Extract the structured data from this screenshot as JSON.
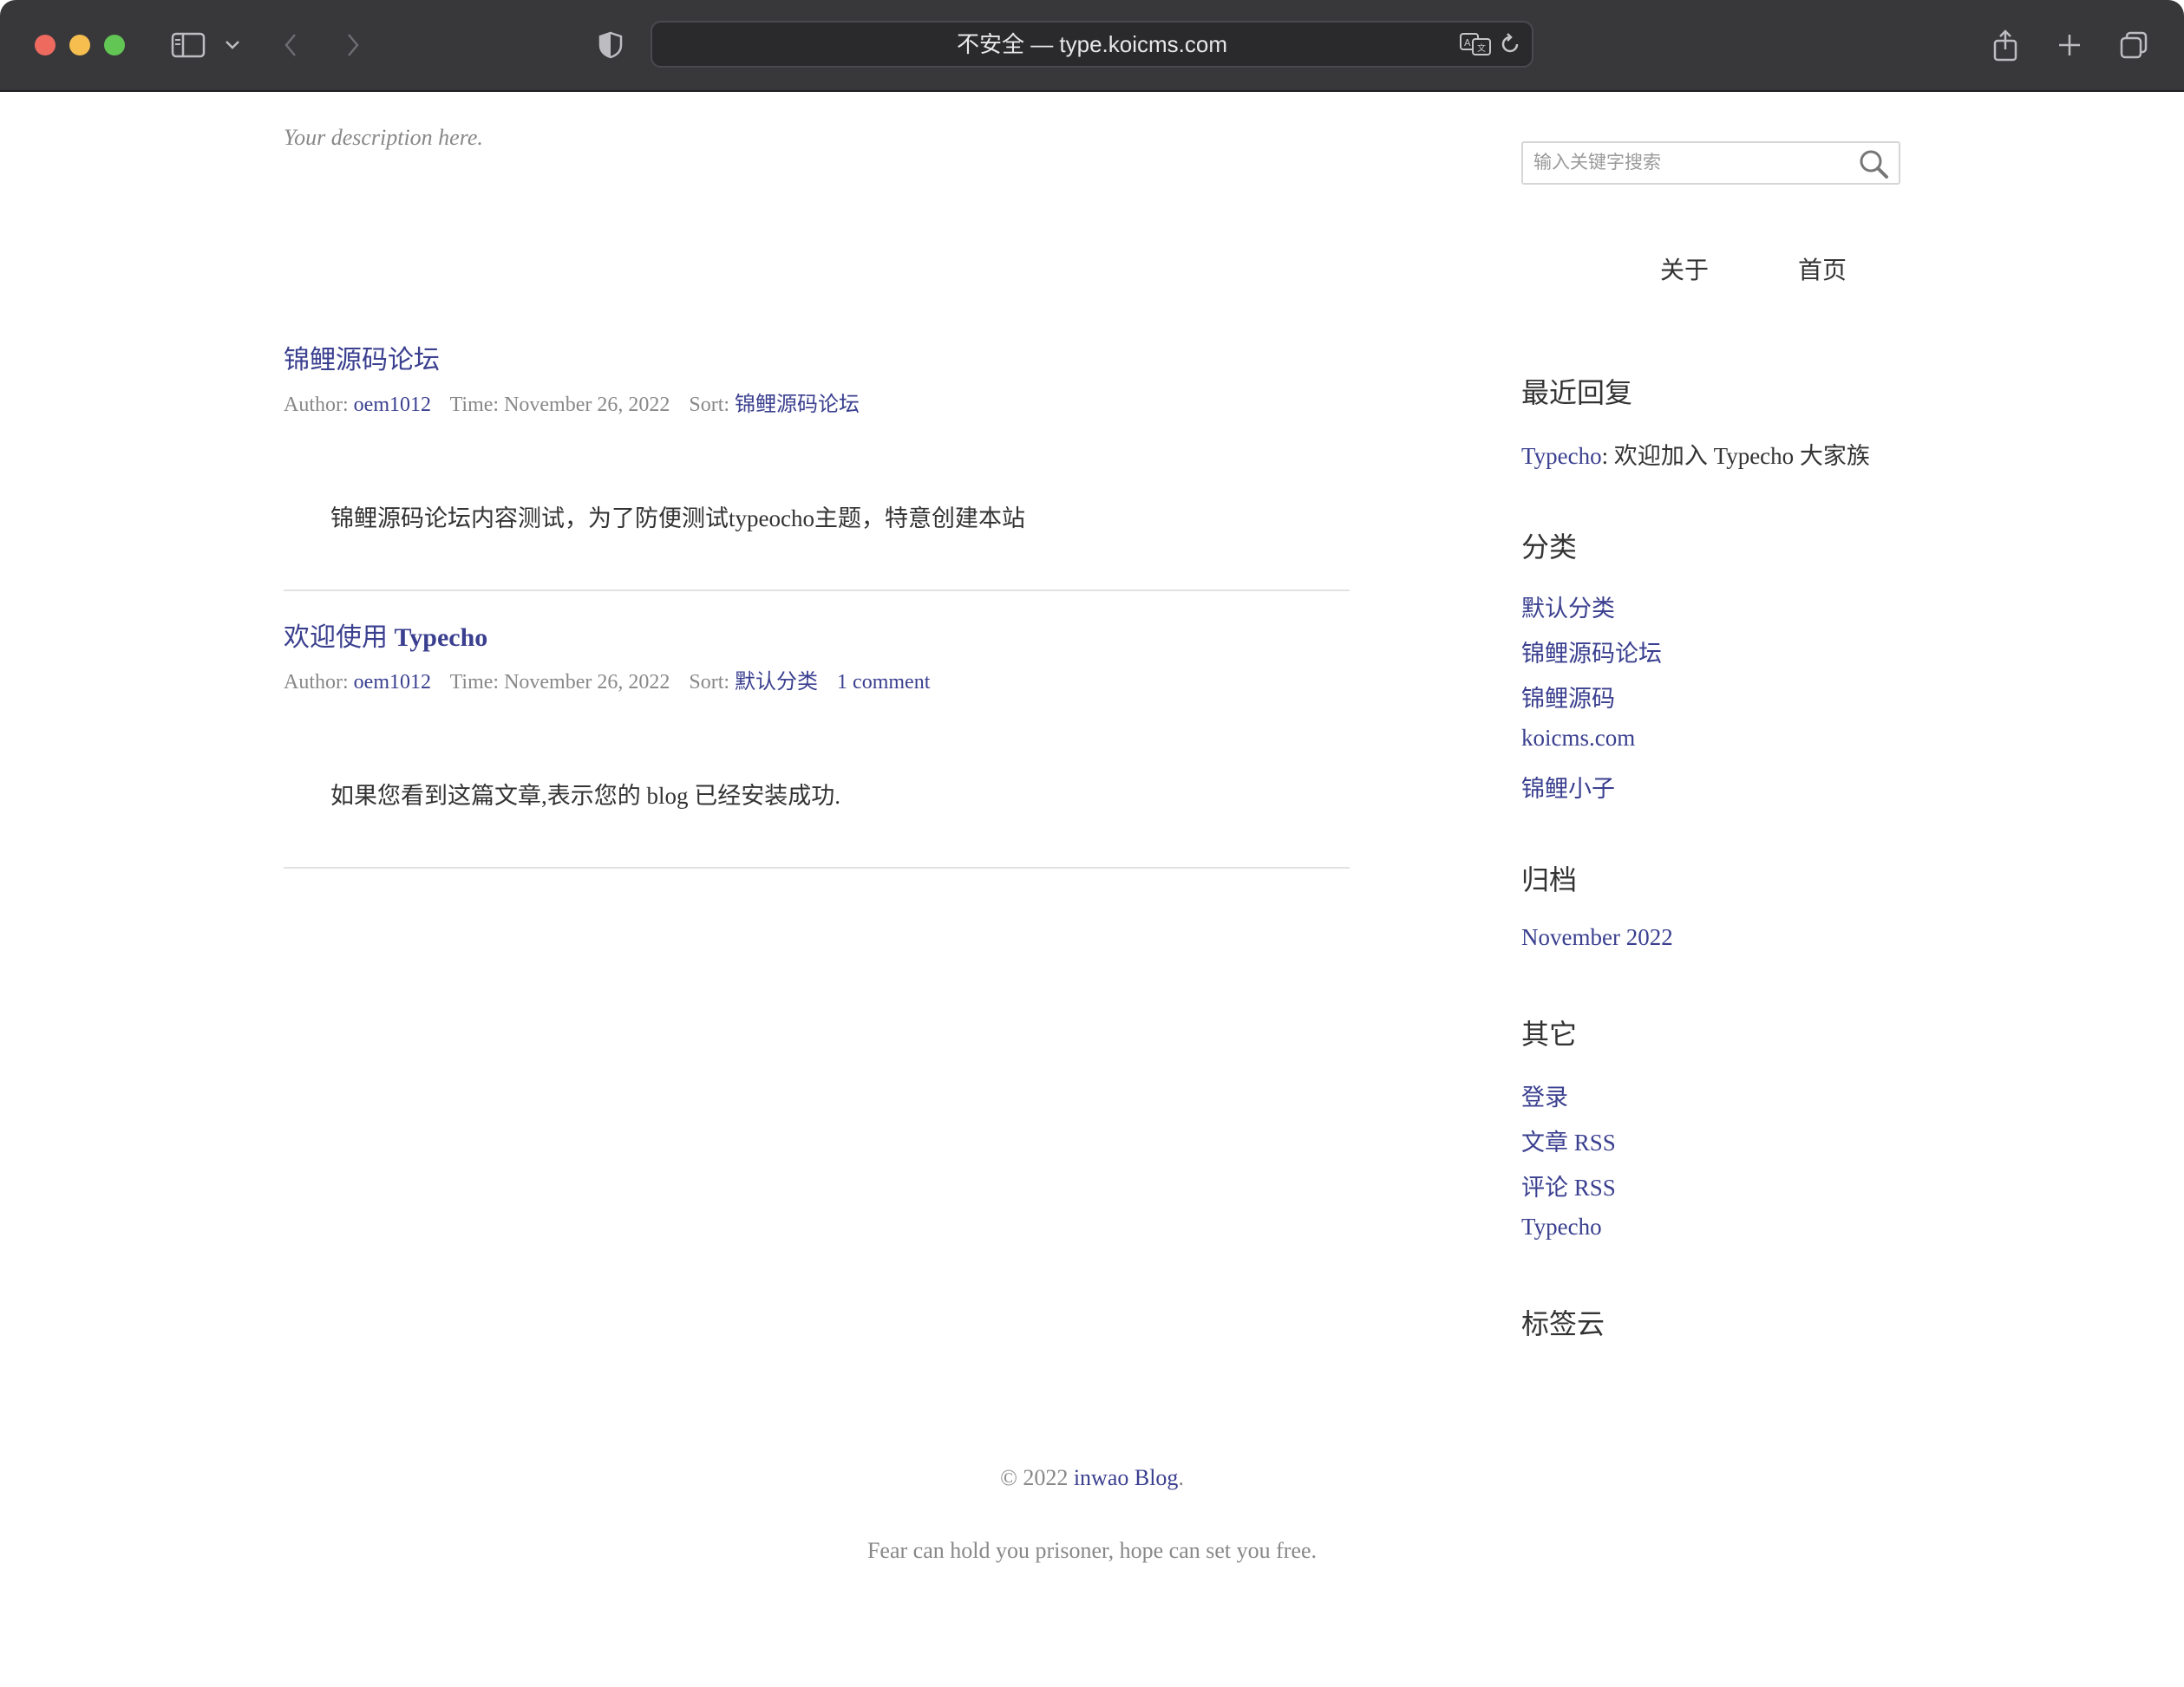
{
  "browser": {
    "url_text": "不安全 — type.koicms.com"
  },
  "site": {
    "description": "Your description here."
  },
  "posts": [
    {
      "title": "锦鲤源码论坛",
      "author_label": "Author:",
      "author": "oem1012",
      "time_label": "Time:",
      "time": "November 26, 2022",
      "sort_label": "Sort:",
      "sort": "锦鲤源码论坛",
      "body": "锦鲤源码论坛内容测试，为了防便测试typeocho主题，特意创建本站"
    },
    {
      "title_cn": "欢迎使用",
      "title_en": "Typecho",
      "author_label": "Author:",
      "author": "oem1012",
      "time_label": "Time:",
      "time": "November 26, 2022",
      "sort_label": "Sort:",
      "sort": "默认分类",
      "comments": "1 comment",
      "body": "如果您看到这篇文章,表示您的 blog 已经安装成功."
    }
  ],
  "search": {
    "placeholder": "输入关键字搜索"
  },
  "nav": [
    {
      "label": "关于"
    },
    {
      "label": "首页"
    }
  ],
  "sidebar": {
    "recent_comments": {
      "title": "最近回复",
      "items": [
        {
          "author": "Typecho",
          "sep": ": ",
          "text": "欢迎加入 Typecho 大家族"
        }
      ]
    },
    "categories": {
      "title": "分类",
      "items": [
        "默认分类",
        "锦鲤源码论坛",
        "锦鲤源码",
        "koicms.com",
        "锦鲤小子"
      ]
    },
    "archives": {
      "title": "归档",
      "items": [
        "November 2022"
      ]
    },
    "misc": {
      "title": "其它",
      "items": [
        "登录",
        "文章 RSS",
        "评论 RSS",
        "Typecho"
      ]
    },
    "tags": {
      "title": "标签云"
    }
  },
  "footer": {
    "copyright_prefix": "© 2022 ",
    "blog_name": "inwao Blog",
    "copyright_suffix": ".",
    "motto": "Fear can hold you prisoner, hope can set you free."
  },
  "colors": {
    "link": "#3a3f8f",
    "chrome": "#38383b"
  }
}
